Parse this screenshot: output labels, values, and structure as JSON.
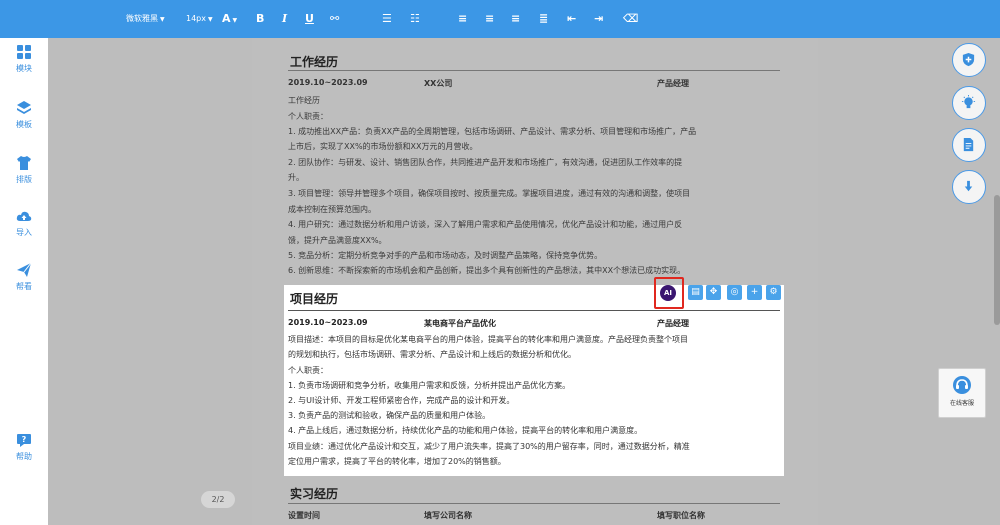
{
  "toolbar": {
    "font_family": "微软雅黑",
    "font_size": "14px",
    "icons": [
      "font-color-icon",
      "bold-icon",
      "italic-icon",
      "underline-icon",
      "link-icon",
      "ordered-list-icon",
      "unordered-list-icon",
      "align-left-icon",
      "align-center-icon",
      "align-right-icon",
      "justify-icon",
      "outdent-icon",
      "indent-icon",
      "clear-format-icon"
    ]
  },
  "sidebar": {
    "items": [
      {
        "label": "模块",
        "icon": "grid-icon"
      },
      {
        "label": "模板",
        "icon": "layers-icon"
      },
      {
        "label": "排版",
        "icon": "shirt-icon"
      },
      {
        "label": "导入",
        "icon": "cloud-upload-icon"
      },
      {
        "label": "帮看",
        "icon": "send-icon"
      },
      {
        "label": "帮助",
        "icon": "help-icon"
      }
    ]
  },
  "page_indicator": "2/2",
  "work": {
    "title": "工作经历",
    "date": "2019.10~2023.09",
    "company": "XX公司",
    "position": "产品经理",
    "lines": [
      "工作经历",
      "个人职责：",
      "1. 成功推出XX产品：负责XX产品的全周期管理，包括市场调研、产品设计、需求分析、项目管理和市场推广，产品",
      "上市后，实现了XX%的市场份额和XX万元的月营收。",
      "2. 团队协作：与研发、设计、销售团队合作，共同推进产品开发和市场推广，有效沟通，促进团队工作效率的提",
      "升。",
      "3. 项目管理：领导并管理多个项目，确保项目按时、按质量完成。掌握项目进度，通过有效的沟通和调整，使项目",
      "成本控制在预算范围内。",
      "4. 用户研究：通过数据分析和用户访谈，深入了解用户需求和产品使用情况，优化产品设计和功能，通过用户反",
      "馈，提升产品满意度XX%。",
      "5. 竞品分析：定期分析竞争对手的产品和市场动态，及时调整产品策略，保持竞争优势。",
      "6. 创新思维：不断探索新的市场机会和产品创新，提出多个具有创新性的产品想法，其中XX个想法已成功实现。"
    ]
  },
  "project": {
    "title": "项目经历",
    "date": "2019.10~2023.09",
    "name": "某电商平台产品优化",
    "position": "产品经理",
    "ai_label": "AI",
    "tool_icons": [
      "ai-icon",
      "settings-icon",
      "move-icon",
      "copy-icon",
      "add-icon",
      "gear-icon"
    ],
    "lines": [
      "项目描述：本项目的目标是优化某电商平台的用户体验，提高平台的转化率和用户满意度。产品经理负责整个项目",
      "的规划和执行，包括市场调研、需求分析、产品设计和上线后的数据分析和优化。",
      "个人职责：",
      "1. 负责市场调研和竞争分析，收集用户需求和反馈，分析并提出产品优化方案。",
      "2. 与UI设计师、开发工程师紧密合作，完成产品的设计和开发。",
      "3. 负责产品的测试和验收，确保产品的质量和用户体验。",
      "4. 产品上线后，通过数据分析，持续优化产品的功能和用户体验，提高平台的转化率和用户满意度。",
      "项目业绩：通过优化产品设计和交互，减少了用户流失率，提高了30%的用户留存率，同时，通过数据分析，精准",
      "定位用户需求，提高了平台的转化率，增加了20%的销售额。"
    ]
  },
  "intern": {
    "title": "实习经历",
    "col1": "设置时间",
    "col2": "填写公司名称",
    "col3": "填写职位名称"
  },
  "right_panel": {
    "buttons": [
      "shield-icon",
      "bulb-icon",
      "document-icon",
      "download-icon"
    ],
    "service_label": "在线客服",
    "service_icon": "headset-icon"
  },
  "colors": {
    "accent": "#3c97e6",
    "highlight_border": "#e0281f",
    "ai_badge": "#3a1670"
  }
}
